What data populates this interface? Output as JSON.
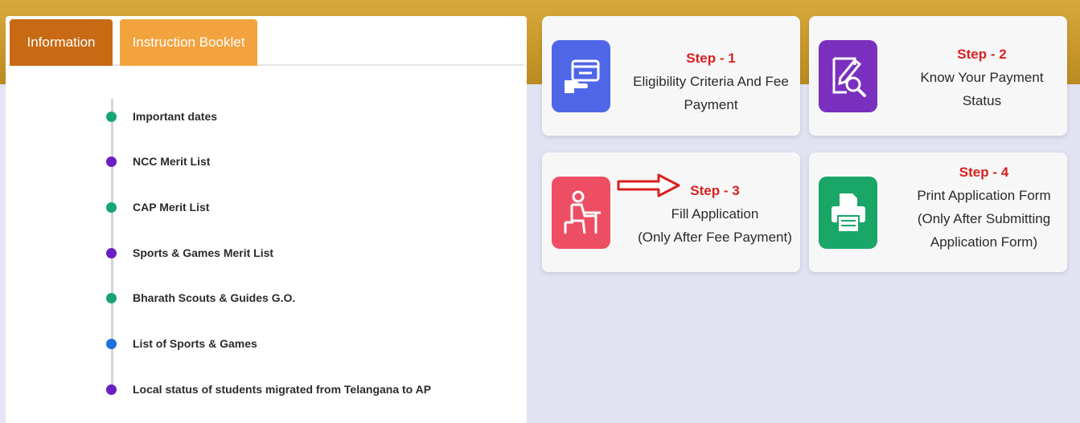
{
  "tabs": [
    {
      "label": "Information"
    },
    {
      "label": "Instruction Booklet"
    }
  ],
  "links": [
    {
      "label": "Important dates",
      "color": "#17a673"
    },
    {
      "label": "NCC Merit List",
      "color": "#6a1fc2"
    },
    {
      "label": "CAP Merit List",
      "color": "#17a673"
    },
    {
      "label": "Sports & Games Merit List",
      "color": "#6a1fc2"
    },
    {
      "label": "Bharath Scouts & Guides G.O.",
      "color": "#17a673"
    },
    {
      "label": "List of Sports & Games",
      "color": "#1f6fe0"
    },
    {
      "label": "Local status of students migrated from Telangana to AP",
      "color": "#6a1fc2"
    }
  ],
  "steps": [
    {
      "step": "Step - 1",
      "line1": "Eligibility Criteria And Fee",
      "line2": "Payment",
      "line3": "",
      "icon": "payment-card-icon",
      "color": "#4f67e6"
    },
    {
      "step": "Step - 2",
      "line1": "Know Your Payment",
      "line2": "Status",
      "line3": "",
      "icon": "document-search-icon",
      "color": "#7b2fbe"
    },
    {
      "step": "Step - 3",
      "line1": "Fill Application",
      "line2": "(Only After Fee Payment)",
      "line3": "",
      "icon": "student-desk-icon",
      "color": "#ee4e63"
    },
    {
      "step": "Step - 4",
      "line1": "Print Application Form",
      "line2": "(Only After Submitting",
      "line3": "Application Form)",
      "icon": "printer-icon",
      "color": "#1aa666"
    }
  ]
}
